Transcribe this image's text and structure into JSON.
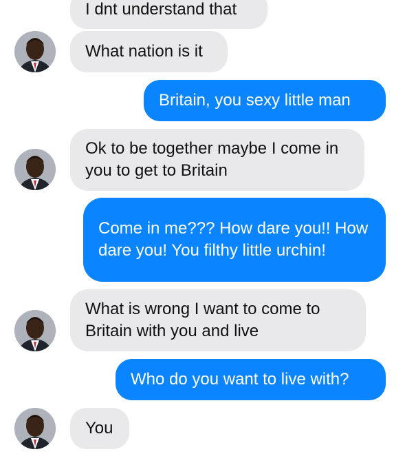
{
  "colors": {
    "incoming_bubble": "#e9e9eb",
    "outgoing_bubble": "#0a84ff",
    "incoming_text": "#111111",
    "outgoing_text": "#ffffff"
  },
  "messages": [
    {
      "from": "contact",
      "text": "I dnt understand that"
    },
    {
      "from": "contact",
      "text": "What nation is it"
    },
    {
      "from": "me",
      "text": "Britain, you sexy little man"
    },
    {
      "from": "contact",
      "text": "Ok to be together maybe I come in you to get to Britain"
    },
    {
      "from": "me",
      "text": "Come in me??? How dare you!! How dare you! You filthy little urchin!"
    },
    {
      "from": "contact",
      "text": "What is wrong I want to come to Britain with you and live"
    },
    {
      "from": "me",
      "text": "Who do you want to live with?"
    },
    {
      "from": "contact",
      "text": "You"
    }
  ],
  "contact_avatar": {
    "icon": "profile-photo-icon"
  }
}
